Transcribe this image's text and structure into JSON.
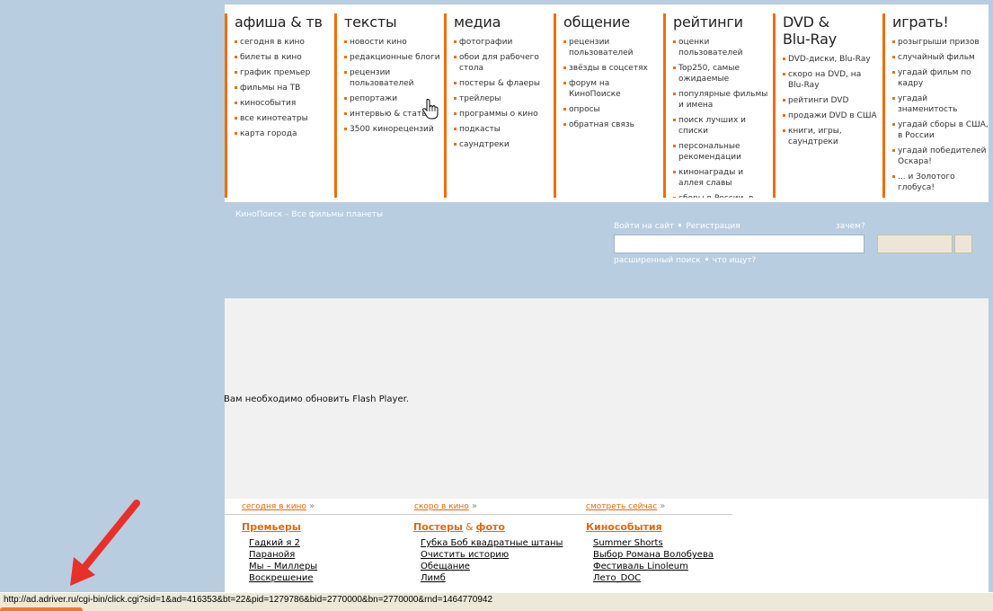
{
  "menu": {
    "columns": [
      {
        "title": "афиша & тв",
        "items": [
          "сегодня в кино",
          "билеты в кино",
          "график премьер",
          "фильмы на ТВ",
          "кинособытия",
          "все кинотеатры",
          "карта города"
        ]
      },
      {
        "title": "тексты",
        "items": [
          "новости кино",
          "редакционные блоги",
          "рецензии пользователей",
          "репортажи",
          "интервью & статьи",
          "3500 кинорецензий"
        ]
      },
      {
        "title": "медиа",
        "items": [
          "фотографии",
          "обои для рабочего стола",
          "постеры & флаеры",
          "трейлеры",
          "программы о кино",
          "подкасты",
          "саундтреки"
        ]
      },
      {
        "title": "общение",
        "items": [
          "рецензии пользователей",
          "звёзды в соцсетях",
          "форум на КиноПоиске",
          "опросы",
          "обратная связь"
        ]
      },
      {
        "title": "рейтинги",
        "items": [
          "оценки пользователей",
          "Top250, самые ожидаемые",
          "популярные фильмы и имена",
          "поиск лучших и списки",
          "персональные рекомендации",
          "кинонаграды и аллея славы",
          "сборы в России, в"
        ]
      },
      {
        "title": "DVD &\nBlu-Ray",
        "items": [
          "DVD-диски, Blu-Ray",
          "скоро на DVD, на Blu-Ray",
          "рейтинги DVD",
          "продажи DVD в США",
          "книги, игры, саундтреки"
        ]
      },
      {
        "title": "играть!",
        "items": [
          "розыгрыши призов",
          "случайный фильм",
          "угадай фильм по кадру",
          "угадай знаменитость",
          "угадай сборы в США, в России",
          "угадай победителей Оскара!",
          "... и Золотого глобуса!"
        ]
      }
    ]
  },
  "header": {
    "tagline": "КиноПоиск – Все фильмы планеты",
    "login": "Войти на сайт",
    "register": "Регистрация",
    "why": "зачем?",
    "search_value": "",
    "advanced_search": "расширенный поиск",
    "popular_searches": "что ищут?"
  },
  "flash": {
    "message": "Вам необходимо обновить Flash Player."
  },
  "content": {
    "toplinks": [
      "сегодня в кино",
      "скоро в кино",
      "смотреть сейчас"
    ],
    "sections": [
      {
        "title": "Премьеры",
        "title_amp": "",
        "title_extra": "",
        "items": [
          "Гадкий я 2",
          "Паранойя",
          "Мы – Миллеры",
          "Воскрешение"
        ]
      },
      {
        "title": "Постеры",
        "title_amp": "&",
        "title_extra": "фото",
        "items": [
          "Губка Боб квадратные штаны",
          "Очистить историю",
          "Обещание",
          "Лимб"
        ]
      },
      {
        "title": "Кинособытия",
        "title_amp": "",
        "title_extra": "",
        "items": [
          "Summer Shorts",
          "Выбор Романа Волобуева",
          "Фестиваль Linoleum",
          "Лето_DOC"
        ]
      }
    ]
  },
  "status": {
    "url": "http://ad.adriver.ru/cgi-bin/click.cgi?sid=1&ad=416353&bt=22&pid=1279786&bid=2770000&bn=2770000&rnd=1464770942"
  },
  "colors": {
    "accent": "#f26c0a",
    "background": "#b8cde0",
    "arrow": "#e8302a"
  }
}
